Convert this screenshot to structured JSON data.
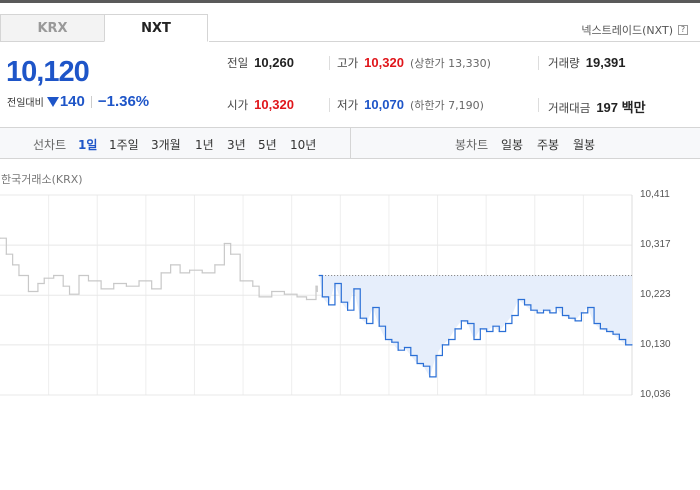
{
  "tabs": [
    {
      "label": "KRX",
      "active": false
    },
    {
      "label": "NXT",
      "active": true
    }
  ],
  "provider": "넥스트레이드(NXT)",
  "help_glyph": "?",
  "price": {
    "current": "10,120",
    "change_label": "전일대비",
    "change": "140",
    "change_pct": "−1.36%",
    "direction": "down"
  },
  "stats": {
    "prev_close": {
      "label": "전일",
      "value": "10,260"
    },
    "high": {
      "label": "고가",
      "value": "10,320",
      "sub": "(상한가 13,330)"
    },
    "volume": {
      "label": "거래량",
      "value": "19,391"
    },
    "open": {
      "label": "시가",
      "value": "10,320"
    },
    "low": {
      "label": "저가",
      "value": "10,070",
      "sub": "(하한가 7,190)"
    },
    "trade_value": {
      "label": "거래대금",
      "value": "197 백만"
    }
  },
  "controls": {
    "line_chart_label": "선차트",
    "periods": [
      "1일",
      "1주일",
      "3개월",
      "1년",
      "3년",
      "5년",
      "10년"
    ],
    "active_period": "1일",
    "candle_chart_label": "봉차트",
    "candle_periods": [
      "일봉",
      "주봉",
      "월봉"
    ]
  },
  "exchange_label": "한국거래소(KRX)",
  "colors": {
    "down": "#1e55c8",
    "up": "#e0161b",
    "krx_line": "#c8c8c8",
    "nxt_line": "#2a6fd6",
    "nxt_fill": "#e6eefb"
  },
  "chart_data": {
    "type": "line",
    "y_ticks": [
      "10,411",
      "10,317",
      "10,223",
      "10,130",
      "10,036"
    ],
    "ylim": [
      10036,
      10411
    ],
    "reference_line": 10260,
    "x_range": [
      0,
      1
    ],
    "series": [
      {
        "values": [
          [
            0.0,
            10330
          ],
          [
            0.01,
            10300
          ],
          [
            0.02,
            10280
          ],
          [
            0.03,
            10260
          ],
          [
            0.045,
            10230
          ],
          [
            0.06,
            10245
          ],
          [
            0.07,
            10255
          ],
          [
            0.085,
            10260
          ],
          [
            0.1,
            10240
          ],
          [
            0.11,
            10225
          ],
          [
            0.125,
            10260
          ],
          [
            0.14,
            10250
          ],
          [
            0.16,
            10235
          ],
          [
            0.18,
            10245
          ],
          [
            0.2,
            10240
          ],
          [
            0.22,
            10250
          ],
          [
            0.24,
            10235
          ],
          [
            0.255,
            10265
          ],
          [
            0.27,
            10280
          ],
          [
            0.285,
            10265
          ],
          [
            0.3,
            10270
          ],
          [
            0.32,
            10265
          ],
          [
            0.34,
            10280
          ],
          [
            0.355,
            10320
          ],
          [
            0.365,
            10300
          ],
          [
            0.38,
            10250
          ],
          [
            0.4,
            10240
          ],
          [
            0.41,
            10220
          ],
          [
            0.43,
            10230
          ],
          [
            0.45,
            10225
          ],
          [
            0.47,
            10220
          ],
          [
            0.485,
            10215
          ],
          [
            0.5,
            10240
          ],
          [
            0.502,
            10230
          ]
        ]
      },
      {
        "values": [
          [
            0.505,
            10260
          ],
          [
            0.51,
            10220
          ],
          [
            0.52,
            10205
          ],
          [
            0.53,
            10245
          ],
          [
            0.54,
            10210
          ],
          [
            0.55,
            10195
          ],
          [
            0.56,
            10235
          ],
          [
            0.57,
            10180
          ],
          [
            0.58,
            10170
          ],
          [
            0.59,
            10200
          ],
          [
            0.6,
            10165
          ],
          [
            0.61,
            10140
          ],
          [
            0.62,
            10135
          ],
          [
            0.63,
            10120
          ],
          [
            0.64,
            10125
          ],
          [
            0.65,
            10110
          ],
          [
            0.66,
            10095
          ],
          [
            0.67,
            10090
          ],
          [
            0.68,
            10070
          ],
          [
            0.69,
            10110
          ],
          [
            0.7,
            10130
          ],
          [
            0.71,
            10140
          ],
          [
            0.72,
            10160
          ],
          [
            0.73,
            10175
          ],
          [
            0.74,
            10170
          ],
          [
            0.75,
            10140
          ],
          [
            0.76,
            10160
          ],
          [
            0.77,
            10155
          ],
          [
            0.78,
            10165
          ],
          [
            0.79,
            10155
          ],
          [
            0.8,
            10170
          ],
          [
            0.81,
            10185
          ],
          [
            0.82,
            10215
          ],
          [
            0.83,
            10205
          ],
          [
            0.84,
            10195
          ],
          [
            0.85,
            10190
          ],
          [
            0.86,
            10195
          ],
          [
            0.87,
            10190
          ],
          [
            0.88,
            10200
          ],
          [
            0.89,
            10185
          ],
          [
            0.9,
            10180
          ],
          [
            0.91,
            10175
          ],
          [
            0.92,
            10190
          ],
          [
            0.93,
            10200
          ],
          [
            0.94,
            10170
          ],
          [
            0.95,
            10160
          ],
          [
            0.96,
            10155
          ],
          [
            0.97,
            10150
          ],
          [
            0.98,
            10140
          ],
          [
            0.99,
            10130
          ],
          [
            1.0,
            10130
          ]
        ]
      }
    ]
  }
}
